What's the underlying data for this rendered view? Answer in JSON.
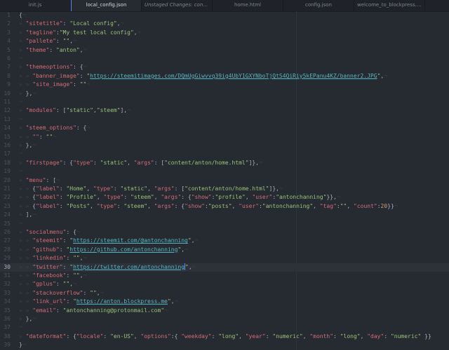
{
  "tabs": [
    {
      "label": "init.js",
      "active": false
    },
    {
      "label": "local_config.json",
      "active": true
    },
    {
      "label": "Unstaged Changes: content...",
      "active": false,
      "italic": true
    },
    {
      "label": "home.html",
      "active": false
    },
    {
      "label": "config.json",
      "active": false
    },
    {
      "label": "welcome_to_blockpress.h...",
      "active": false
    }
  ],
  "colors": {
    "key": "#d46c75",
    "string": "#98c379",
    "url": "#56b6c2",
    "number": "#d19a66",
    "background": "#262a31",
    "cursor": "#528bff"
  },
  "cursor_line": 30,
  "lines": [
    {
      "i": 0,
      "t": [
        [
          "p",
          "{"
        ]
      ]
    },
    {
      "i": 1,
      "t": [
        [
          "k",
          "\"sitetitle\""
        ],
        [
          "p",
          ": "
        ],
        [
          "s",
          "\"Local config\""
        ],
        [
          "p",
          ","
        ]
      ]
    },
    {
      "i": 1,
      "t": [
        [
          "k",
          "\"tagline\""
        ],
        [
          "p",
          ":"
        ],
        [
          "s",
          "\"My test local config\""
        ],
        [
          "p",
          ","
        ]
      ]
    },
    {
      "i": 1,
      "t": [
        [
          "k",
          "\"pallete\""
        ],
        [
          "p",
          ": "
        ],
        [
          "s",
          "\"\""
        ],
        [
          "p",
          ","
        ]
      ]
    },
    {
      "i": 1,
      "t": [
        [
          "k",
          "\"theme\""
        ],
        [
          "p",
          ": "
        ],
        [
          "s",
          "\"anton\""
        ],
        [
          "p",
          ","
        ]
      ]
    },
    {
      "i": 0,
      "t": []
    },
    {
      "i": 1,
      "t": [
        [
          "k",
          "\"themeoptions\""
        ],
        [
          "p",
          ": {"
        ]
      ]
    },
    {
      "i": 2,
      "t": [
        [
          "k",
          "\"banner_image\""
        ],
        [
          "p",
          ": "
        ],
        [
          "s",
          "\""
        ],
        [
          "u",
          "https://steemitimages.com/DQmUgGiwvvq39ig4UbY1GXYNboTjQtS4QiRiy5kEPanu4KZ/banner2.JPG"
        ],
        [
          "s",
          "\""
        ],
        [
          "p",
          ","
        ]
      ]
    },
    {
      "i": 2,
      "t": [
        [
          "k",
          "\"site_image\""
        ],
        [
          "p",
          ": "
        ],
        [
          "s",
          "\"\""
        ]
      ]
    },
    {
      "i": 1,
      "t": [
        [
          "p",
          "},"
        ]
      ]
    },
    {
      "i": 0,
      "t": []
    },
    {
      "i": 1,
      "t": [
        [
          "k",
          "\"modules\""
        ],
        [
          "p",
          ": ["
        ],
        [
          "s",
          "\"static\""
        ],
        [
          "p",
          ","
        ],
        [
          "s",
          "\"steem\""
        ],
        [
          "p",
          "],"
        ]
      ]
    },
    {
      "i": 0,
      "t": []
    },
    {
      "i": 1,
      "t": [
        [
          "k",
          "\"steem_options\""
        ],
        [
          "p",
          ": {"
        ]
      ]
    },
    {
      "i": 2,
      "t": [
        [
          "k",
          "\"\""
        ],
        [
          "p",
          ": "
        ],
        [
          "s",
          "\"\""
        ]
      ]
    },
    {
      "i": 1,
      "t": [
        [
          "p",
          "},"
        ]
      ]
    },
    {
      "i": 0,
      "t": []
    },
    {
      "i": 1,
      "t": [
        [
          "k",
          "\"firstpage\""
        ],
        [
          "p",
          ": {"
        ],
        [
          "k",
          "\"type\""
        ],
        [
          "p",
          ": "
        ],
        [
          "s",
          "\"static\""
        ],
        [
          "p",
          ", "
        ],
        [
          "k",
          "\"args\""
        ],
        [
          "p",
          ": ["
        ],
        [
          "s",
          "\"content/anton/home.html\""
        ],
        [
          "p",
          "]},"
        ]
      ]
    },
    {
      "i": 0,
      "t": []
    },
    {
      "i": 1,
      "t": [
        [
          "k",
          "\"menu\""
        ],
        [
          "p",
          ": ["
        ]
      ]
    },
    {
      "i": 2,
      "t": [
        [
          "p",
          "{"
        ],
        [
          "k",
          "\"label\""
        ],
        [
          "p",
          ": "
        ],
        [
          "s",
          "\"Home\""
        ],
        [
          "p",
          ", "
        ],
        [
          "k",
          "\"type\""
        ],
        [
          "p",
          ": "
        ],
        [
          "s",
          "\"static\""
        ],
        [
          "p",
          ", "
        ],
        [
          "k",
          "\"args\""
        ],
        [
          "p",
          ": ["
        ],
        [
          "s",
          "\"content/anton/home.html\""
        ],
        [
          "p",
          "]},"
        ]
      ]
    },
    {
      "i": 2,
      "t": [
        [
          "p",
          "{"
        ],
        [
          "k",
          "\"label\""
        ],
        [
          "p",
          ": "
        ],
        [
          "s",
          "\"Profile\""
        ],
        [
          "p",
          ", "
        ],
        [
          "k",
          "\"type\""
        ],
        [
          "p",
          ": "
        ],
        [
          "s",
          "\"steem\""
        ],
        [
          "p",
          ", "
        ],
        [
          "k",
          "\"args\""
        ],
        [
          "p",
          ": {"
        ],
        [
          "k",
          "\"show\""
        ],
        [
          "p",
          ":"
        ],
        [
          "s",
          "\"profile\""
        ],
        [
          "p",
          ", "
        ],
        [
          "k",
          "\"user\""
        ],
        [
          "p",
          ":"
        ],
        [
          "s",
          "\"antonchanning\""
        ],
        [
          "p",
          "}},"
        ]
      ]
    },
    {
      "i": 2,
      "t": [
        [
          "p",
          "{"
        ],
        [
          "k",
          "\"label\""
        ],
        [
          "p",
          ": "
        ],
        [
          "s",
          "\"Posts\""
        ],
        [
          "p",
          ", "
        ],
        [
          "k",
          "\"type\""
        ],
        [
          "p",
          ": "
        ],
        [
          "s",
          "\"steem\""
        ],
        [
          "p",
          ", "
        ],
        [
          "k",
          "\"args\""
        ],
        [
          "p",
          ": {"
        ],
        [
          "k",
          "\"show\""
        ],
        [
          "p",
          ":"
        ],
        [
          "s",
          "\"posts\""
        ],
        [
          "p",
          ", "
        ],
        [
          "k",
          "\"user\""
        ],
        [
          "p",
          ":"
        ],
        [
          "s",
          "\"antonchanning\""
        ],
        [
          "p",
          ", "
        ],
        [
          "k",
          "\"tag\""
        ],
        [
          "p",
          ":"
        ],
        [
          "s",
          "\"\""
        ],
        [
          "p",
          ", "
        ],
        [
          "k",
          "\"count\""
        ],
        [
          "p",
          ":"
        ],
        [
          "n",
          "20"
        ],
        [
          "p",
          "}}"
        ]
      ]
    },
    {
      "i": 1,
      "t": [
        [
          "p",
          "],"
        ]
      ]
    },
    {
      "i": 0,
      "t": []
    },
    {
      "i": 1,
      "t": [
        [
          "k",
          "\"socialmenu\""
        ],
        [
          "p",
          ": {"
        ]
      ]
    },
    {
      "i": 2,
      "t": [
        [
          "k",
          "\"steemit\""
        ],
        [
          "p",
          ": "
        ],
        [
          "s",
          "\""
        ],
        [
          "u",
          "https://steemit.com/@antonchanning"
        ],
        [
          "s",
          "\""
        ],
        [
          "p",
          ","
        ]
      ]
    },
    {
      "i": 2,
      "t": [
        [
          "k",
          "\"github\""
        ],
        [
          "p",
          ": "
        ],
        [
          "s",
          "\""
        ],
        [
          "u",
          "https://github.com/antonchanning"
        ],
        [
          "s",
          "\""
        ],
        [
          "p",
          ","
        ]
      ]
    },
    {
      "i": 2,
      "t": [
        [
          "k",
          "\"linkedin\""
        ],
        [
          "p",
          ": "
        ],
        [
          "s",
          "\"\""
        ],
        [
          "p",
          ","
        ]
      ]
    },
    {
      "i": 2,
      "t": [
        [
          "k",
          "\"twitter\""
        ],
        [
          "p",
          ": "
        ],
        [
          "s",
          "\""
        ],
        [
          "u",
          "https://twitter.com/antonchanning"
        ],
        [
          "c",
          ""
        ],
        [
          "s",
          "\""
        ],
        [
          "p",
          ","
        ]
      ]
    },
    {
      "i": 2,
      "t": [
        [
          "k",
          "\"facebook\""
        ],
        [
          "p",
          ": "
        ],
        [
          "s",
          "\"\""
        ],
        [
          "p",
          ","
        ]
      ]
    },
    {
      "i": 2,
      "t": [
        [
          "k",
          "\"gplus\""
        ],
        [
          "p",
          ": "
        ],
        [
          "s",
          "\"\""
        ],
        [
          "p",
          ","
        ]
      ]
    },
    {
      "i": 2,
      "t": [
        [
          "k",
          "\"stackoverflow\""
        ],
        [
          "p",
          ": "
        ],
        [
          "s",
          "\"\""
        ],
        [
          "p",
          ","
        ]
      ]
    },
    {
      "i": 2,
      "t": [
        [
          "k",
          "\"link_url\""
        ],
        [
          "p",
          ": "
        ],
        [
          "s",
          "\""
        ],
        [
          "u",
          "https://anton.blockpress.me"
        ],
        [
          "s",
          "\""
        ],
        [
          "p",
          ","
        ]
      ]
    },
    {
      "i": 2,
      "t": [
        [
          "k",
          "\"email\""
        ],
        [
          "p",
          ": "
        ],
        [
          "s",
          "\"antonchanning@protonmail.com\""
        ]
      ]
    },
    {
      "i": 1,
      "t": [
        [
          "p",
          "},"
        ]
      ]
    },
    {
      "i": 0,
      "t": []
    },
    {
      "i": 1,
      "t": [
        [
          "k",
          "\"dateformat\""
        ],
        [
          "p",
          ": {"
        ],
        [
          "k",
          "\"locale\""
        ],
        [
          "p",
          ": "
        ],
        [
          "s",
          "\"en-US\""
        ],
        [
          "p",
          ", "
        ],
        [
          "k",
          "\"options\""
        ],
        [
          "p",
          ":{ "
        ],
        [
          "k",
          "\"weekday\""
        ],
        [
          "p",
          ": "
        ],
        [
          "s",
          "\"long\""
        ],
        [
          "p",
          ", "
        ],
        [
          "k",
          "\"year\""
        ],
        [
          "p",
          ": "
        ],
        [
          "s",
          "\"numeric\""
        ],
        [
          "p",
          ", "
        ],
        [
          "k",
          "\"month\""
        ],
        [
          "p",
          ": "
        ],
        [
          "s",
          "\"long\""
        ],
        [
          "p",
          ", "
        ],
        [
          "k",
          "\"day\""
        ],
        [
          "p",
          ": "
        ],
        [
          "s",
          "\"numeric\""
        ],
        [
          "p",
          " }}"
        ]
      ]
    },
    {
      "i": 0,
      "t": [
        [
          "p",
          "}"
        ]
      ]
    }
  ]
}
